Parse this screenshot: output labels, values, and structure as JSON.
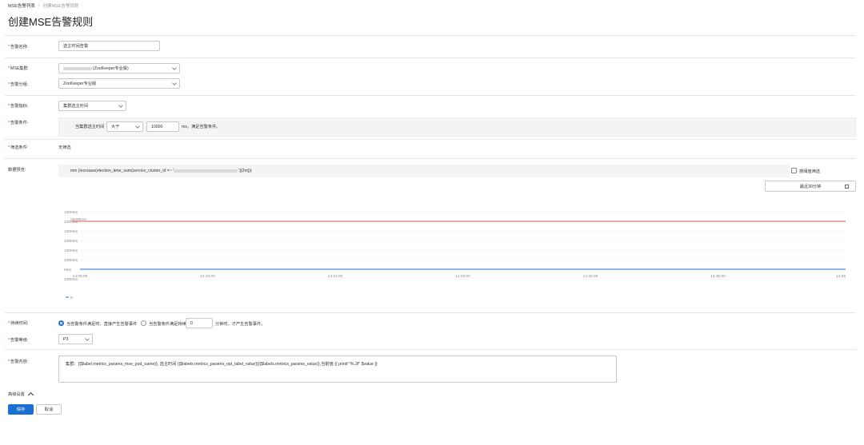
{
  "breadcrumb": {
    "parent": "MSE告警列表",
    "separator": "/",
    "current": "创建MSE告警规则"
  },
  "page_title": "创建MSE告警规则",
  "form": {
    "alert_name": {
      "label": "告警名称:",
      "value": "选主时间告警"
    },
    "mse_cluster": {
      "label": "MSE集群",
      "value_suffix": "(ZooKeeper专业版)"
    },
    "alert_group": {
      "label": "告警分组:",
      "value": "ZooKeeper专业版"
    },
    "alert_metric": {
      "label": "告警指标:",
      "value": "集群选主时间"
    },
    "alert_condition": {
      "label": "告警条件:",
      "prefix": "当集群选主时间",
      "operator": "大于",
      "threshold": "10000",
      "suffix": "ms，满足告警条件。"
    },
    "filter_condition": {
      "label": "筛选条件:",
      "value": "无筛选"
    },
    "data_preview": {
      "label": "数据预览:",
      "query_prefix": "min (increase(election_time_sum{service_cluster_id =~ '",
      "query_suffix": "'}[2m]))",
      "threshold_checkbox_label": "按阈值筛选",
      "time_range": "最近30分钟"
    },
    "duration": {
      "label": "持续时间:",
      "option1": "当告警条件满足时，直接产生告警事件",
      "option2_prefix": "当告警条件满足持续",
      "option2_value": "0",
      "option2_suffix": "分钟时，才产生告警事件。"
    },
    "alert_level": {
      "label": "告警等级:",
      "value": "P3"
    },
    "alert_content": {
      "label": "告警内容:",
      "value": "集群：{{$label.metrics_params_mse_pod_name}}, 选主时间 {{$labels.metrics_params_opt_label_value}}{{$labels.metrics_params_value}},当前值 {{ printf \"%.2f\" $value }}"
    },
    "advanced": {
      "label": "高级设置"
    }
  },
  "buttons": {
    "save": "保存",
    "cancel": "取消"
  },
  "chart_data": {
    "type": "line",
    "x_ticks": [
      "14:05:00",
      "14:10:00",
      "14:15:00",
      "14:20:00",
      "14:25:00",
      "14:30:00",
      "14:35"
    ],
    "y_ticks": [
      "1000ms",
      "1000ms",
      "1000ms",
      "1000ms",
      "1000ms",
      "1000ms",
      "0ms",
      "1000ms"
    ],
    "threshold_label": "10000ms",
    "series": [
      {
        "name": "0",
        "color": "#1a6fd1",
        "value": "0ms"
      }
    ],
    "threshold_color": "#d9534f",
    "legend_position": "bottom-left"
  }
}
